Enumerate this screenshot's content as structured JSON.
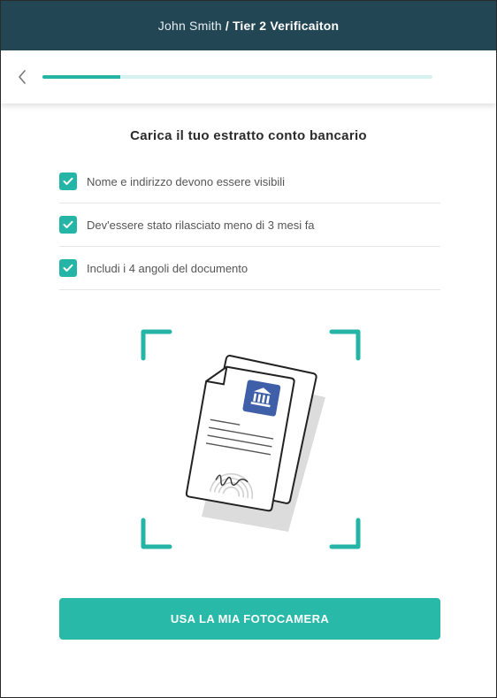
{
  "header": {
    "user_name": "John Smith",
    "separator": "/",
    "flow_title": "Tier 2 Verificaiton"
  },
  "nav": {
    "back_icon": "chevron-left-icon",
    "progress_fraction": 0.2
  },
  "main": {
    "title": "Carica il tuo estratto conto bancario",
    "requirements": [
      {
        "label": "Nome e indirizzo devono essere visibili",
        "icon": "checkbox-checked-icon"
      },
      {
        "label": "Dev'essere stato rilasciato meno di 3 mesi fa",
        "icon": "checkbox-checked-icon"
      },
      {
        "label": "Includi i 4 angoli del documento",
        "icon": "checkbox-checked-icon"
      }
    ],
    "illustration": "bank-document-scan-illustration",
    "cta_label": "USA LA MIA FOTOCAMERA"
  },
  "colors": {
    "header_bg": "#234655",
    "accent": "#25b5a6",
    "progress_track": "#d5f2f1",
    "bank_icon_bg": "#3f5fa8"
  }
}
